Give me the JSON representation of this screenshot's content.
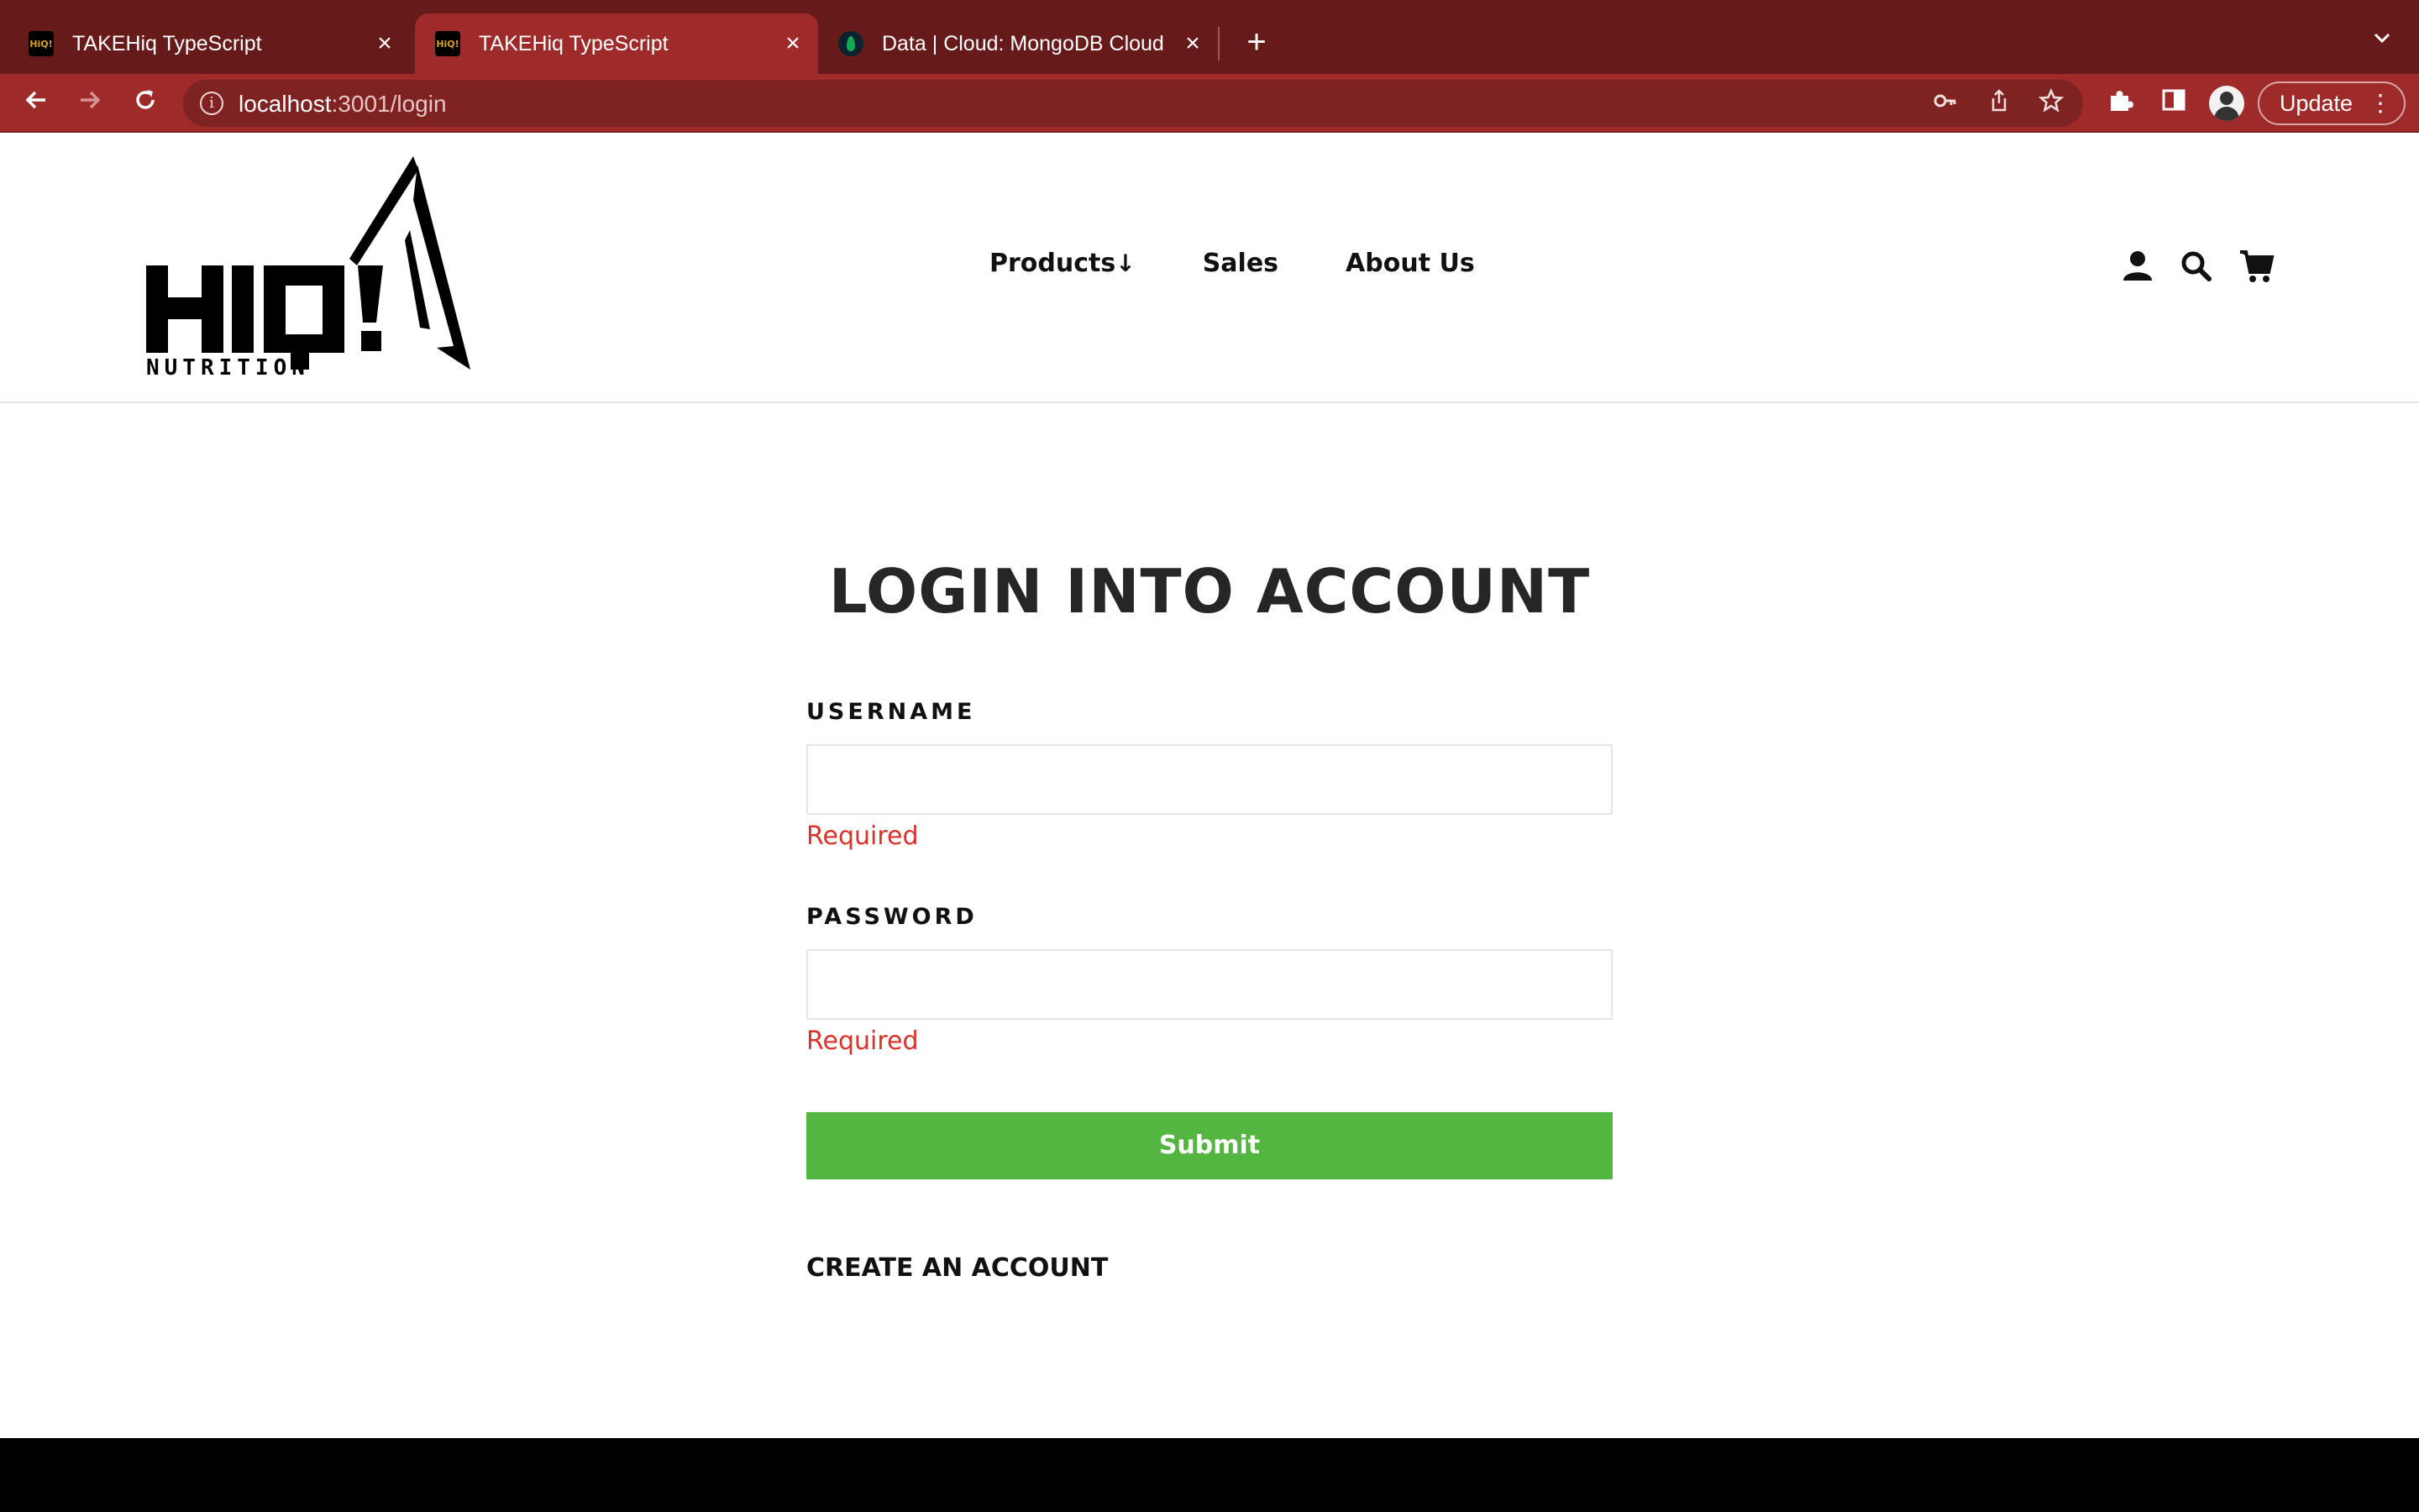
{
  "browser": {
    "tabs": [
      {
        "title": "TAKEHiq TypeScript",
        "favicon": "hiq-favicon",
        "active": false
      },
      {
        "title": "TAKEHiq TypeScript",
        "favicon": "hiq-favicon",
        "active": true
      },
      {
        "title": "Data | Cloud: MongoDB Cloud",
        "favicon": "mongodb-leaf-favicon",
        "active": false
      }
    ],
    "url_host": "localhost",
    "url_path": ":3001/login",
    "update_label": "Update",
    "colors": {
      "tabstrip": "#661a1a",
      "toolbar": "#9e2a2a"
    }
  },
  "site": {
    "logo_text": "HIQ!",
    "logo_subtext": "NUTRITION",
    "nav": {
      "products": "Products",
      "products_arrow": "↓",
      "sales": "Sales",
      "about": "About Us"
    }
  },
  "login": {
    "title": "LOGIN INTO ACCOUNT",
    "username_label": "USERNAME",
    "username_value": "",
    "username_error": "Required",
    "password_label": "PASSWORD",
    "password_value": "",
    "password_error": "Required",
    "submit_label": "Submit",
    "create_account_label": "CREATE AN ACCOUNT",
    "colors": {
      "submit": "#52b640",
      "error": "#d8322a"
    }
  }
}
